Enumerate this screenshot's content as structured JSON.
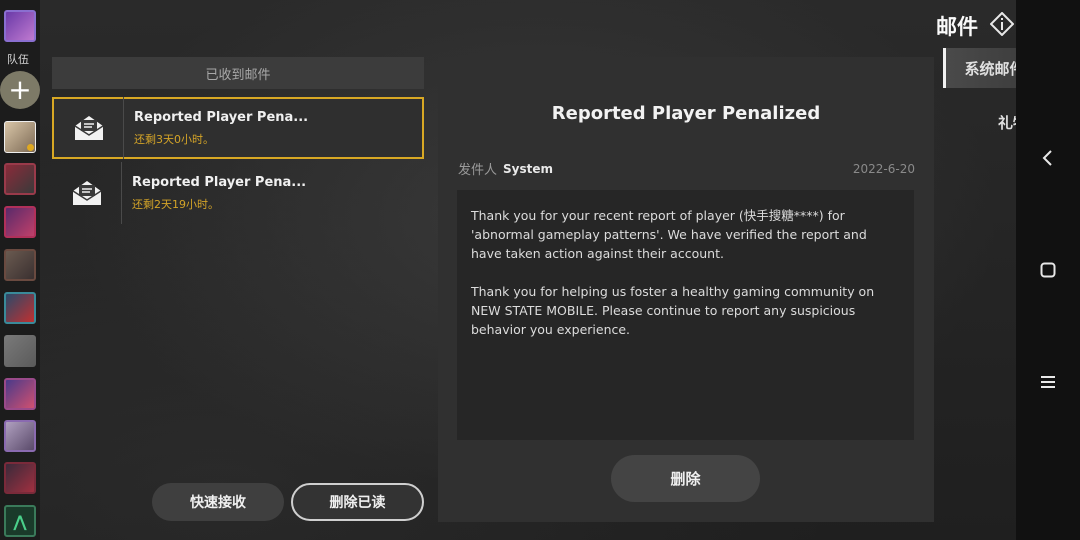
{
  "team": {
    "label": "队伍",
    "avatars": [
      "avatar-leader",
      "avatar-1",
      "avatar-2",
      "avatar-3",
      "avatar-4",
      "avatar-5",
      "avatar-6",
      "avatar-7",
      "avatar-8",
      "avatar-9",
      "avatar-10"
    ]
  },
  "mail_list": {
    "header": "已收到邮件",
    "items": [
      {
        "title": "Reported Player Pena...",
        "time_left": "还剩3天0小时。",
        "selected": true
      },
      {
        "title": "Reported Player Pena...",
        "time_left": "还剩2天19小时。",
        "selected": false
      }
    ],
    "quick_receive_label": "快速接收",
    "delete_read_label": "删除已读"
  },
  "detail": {
    "title": "Reported Player Penalized",
    "sender_label": "发件人",
    "sender_name": "System",
    "date": "2022-6-20",
    "body_p1": "Thank you for your recent report of player (快手搜糖****) for 'abnormal gameplay patterns'. We have verified the report and have taken action against their account.",
    "body_p2": "Thank you for helping us foster a healthy gaming community on NEW STATE MOBILE. Please continue to report any suspicious behavior you experience.",
    "delete_label": "删除"
  },
  "header": {
    "title": "邮件",
    "info_icon": "info-diamond-icon",
    "close_icon": "close-icon"
  },
  "tabs": [
    {
      "label": "系统邮件",
      "active": true
    },
    {
      "label": "礼物",
      "active": false
    }
  ],
  "colors": {
    "accent_gold": "#d8a824",
    "panel": "#303030",
    "background": "#262626"
  }
}
